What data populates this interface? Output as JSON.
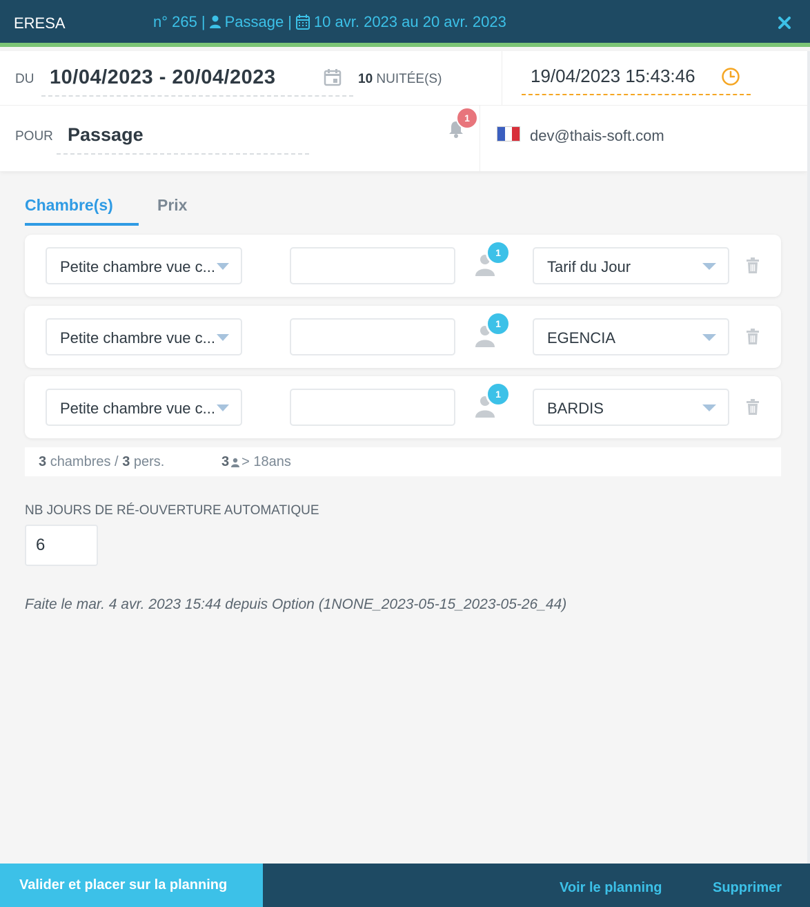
{
  "header": {
    "app_name": "ERESA",
    "number": "n° 265",
    "sep1": "|",
    "type": "Passage",
    "sep2": "|",
    "period": "10 avr. 2023 au 20 avr. 2023",
    "icon_user": "user-icon",
    "icon_calendar": "calendar-icon",
    "icon_close": "close-icon"
  },
  "stay": {
    "from_label": "DU",
    "dates": "10/04/2023 - 20/04/2023",
    "nights_count": "10",
    "nights_label": "NUITÉE(S)",
    "datetime": "19/04/2023 15:43:46",
    "for_label": "POUR",
    "guest_name": "Passage",
    "notifications": "1",
    "email": "dev@thais-soft.com",
    "flag_colors": [
      "#3b5fc0",
      "#ffffff",
      "#d8303b"
    ]
  },
  "tabs": [
    {
      "label": "Chambre(s)",
      "active": true
    },
    {
      "label": "Prix",
      "active": false
    }
  ],
  "rooms": [
    {
      "room": "Petite chambre vue c...",
      "persons": "1",
      "rate": "Tarif du Jour"
    },
    {
      "room": "Petite chambre vue c...",
      "persons": "1",
      "rate": "EGENCIA"
    },
    {
      "room": "Petite chambre vue c...",
      "persons": "1",
      "rate": "BARDIS"
    }
  ],
  "summary": {
    "rooms_count": "3",
    "rooms_label": "chambres /",
    "persons_count": "3",
    "persons_label": "pers.",
    "adults_count": "3",
    "adults_label": "> 18ans"
  },
  "reopen": {
    "label": "NB JOURS DE RÉ-OUVERTURE AUTOMATIQUE",
    "value": "6"
  },
  "history": "Faite le mar. 4 avr. 2023 15:44 depuis Option (1NONE_2023-05-15_2023-05-26_44)",
  "footer": {
    "validate": "Valider et placer sur la planning",
    "view_planning": "Voir le planning",
    "delete": "Supprimer"
  },
  "colors": {
    "header_bg": "#1e4a63",
    "accent": "#3cc1e8",
    "tab_active": "#2f9be4",
    "clock": "#f5a623",
    "badge_red": "#e8757c",
    "green_bar": "#7cc576"
  }
}
